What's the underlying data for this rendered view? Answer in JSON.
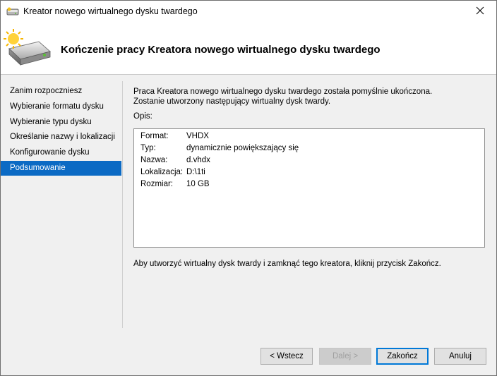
{
  "window": {
    "title": "Kreator nowego wirtualnego dysku twardego",
    "close_glyph": "✕"
  },
  "header": {
    "title": "Kończenie pracy Kreatora nowego wirtualnego dysku twardego",
    "icon": "hard-disk-wizard-icon"
  },
  "sidebar": {
    "items": [
      {
        "label": "Zanim rozpoczniesz",
        "active": false
      },
      {
        "label": "Wybieranie formatu dysku",
        "active": false
      },
      {
        "label": "Wybieranie typu dysku",
        "active": false
      },
      {
        "label": "Określanie nazwy i lokalizacji",
        "active": false
      },
      {
        "label": "Konfigurowanie dysku",
        "active": false
      },
      {
        "label": "Podsumowanie",
        "active": true
      }
    ]
  },
  "content": {
    "intro": "Praca Kreatora nowego wirtualnego dysku twardego została pomyślnie ukończona. Zostanie utworzony następujący wirtualny dysk twardy.",
    "description_label": "Opis:",
    "description_rows": [
      {
        "key": "Format:",
        "value": "VHDX"
      },
      {
        "key": "Typ:",
        "value": "dynamicznie powiększający się"
      },
      {
        "key": "Nazwa:",
        "value": "d.vhdx"
      },
      {
        "key": "Lokalizacja:",
        "value": "D:\\1ti"
      },
      {
        "key": "Rozmiar:",
        "value": "10 GB"
      }
    ],
    "finish_note": "Aby utworzyć wirtualny dysk twardy i zamknąć tego kreatora, kliknij przycisk Zakończ."
  },
  "buttons": {
    "back": "< Wstecz",
    "next": "Dalej >",
    "finish": "Zakończ",
    "cancel": "Anuluj"
  },
  "colors": {
    "accent": "#0b6ac4",
    "default_button_border": "#0078d7"
  }
}
